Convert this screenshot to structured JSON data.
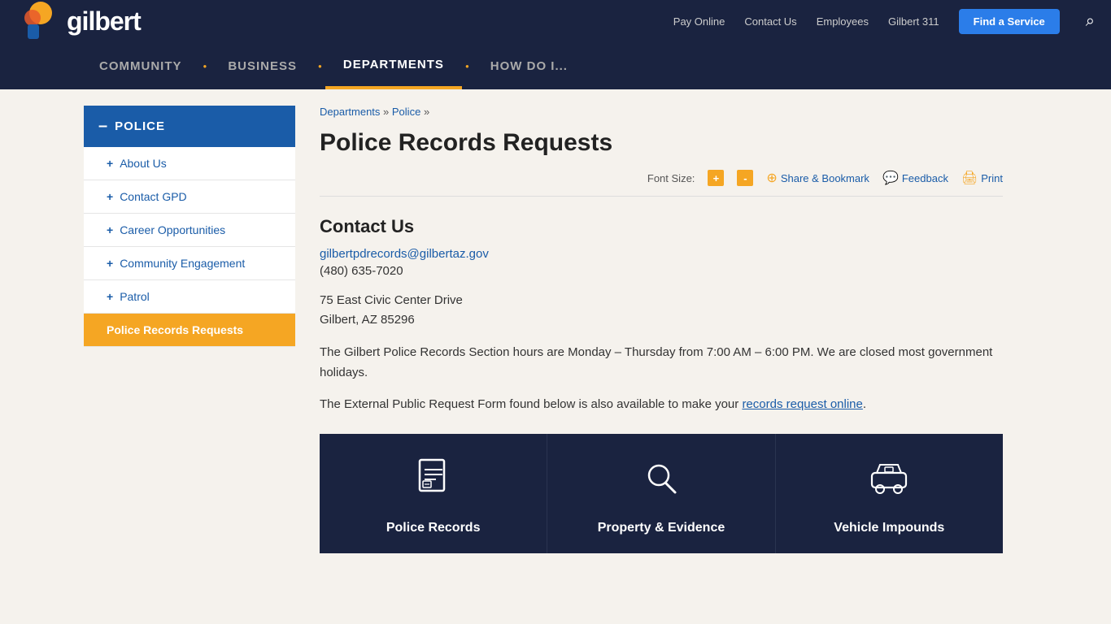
{
  "topbar": {
    "logo_text": "gilbert",
    "links": [
      "Pay Online",
      "Contact Us",
      "Employees",
      "Gilbert 311"
    ],
    "find_service": "Find a Service"
  },
  "nav": {
    "items": [
      "COMMUNITY",
      "BUSINESS",
      "DEPARTMENTS",
      "HOW DO I..."
    ],
    "active": "DEPARTMENTS"
  },
  "sidebar": {
    "header": "POLICE",
    "items": [
      {
        "label": "About Us",
        "active": false,
        "plus": true
      },
      {
        "label": "Contact GPD",
        "active": false,
        "plus": true
      },
      {
        "label": "Career Opportunities",
        "active": false,
        "plus": true
      },
      {
        "label": "Community Engagement",
        "active": false,
        "plus": true
      },
      {
        "label": "Patrol",
        "active": false,
        "plus": true
      },
      {
        "label": "Police Records Requests",
        "active": true,
        "plus": false
      }
    ]
  },
  "breadcrumb": {
    "items": [
      "Departments",
      "Police"
    ],
    "separator": "»"
  },
  "main": {
    "title": "Police Records Requests",
    "toolbar": {
      "font_size_label": "Font Size:",
      "font_plus": "+",
      "font_minus": "-",
      "share": "Share & Bookmark",
      "feedback": "Feedback",
      "print": "Print"
    },
    "contact_section": {
      "title": "Contact Us",
      "email": "gilbertpdrecords@gilbertaz.gov",
      "phone": "(480) 635-7020",
      "address_line1": "75 East Civic Center Drive",
      "address_line2": "Gilbert, AZ 85296"
    },
    "info_text1": "The Gilbert Police Records Section hours are Monday – Thursday from 7:00 AM – 6:00 PM. We are closed most government holidays.",
    "info_text2_prefix": "The External Public Request Form found below is also available to make your ",
    "info_text2_link": "records request online",
    "info_text2_suffix": ".",
    "cards": [
      {
        "label": "Police Records",
        "icon": "document"
      },
      {
        "label": "Property & Evidence",
        "icon": "search"
      },
      {
        "label": "Vehicle Impounds",
        "icon": "car"
      }
    ]
  }
}
